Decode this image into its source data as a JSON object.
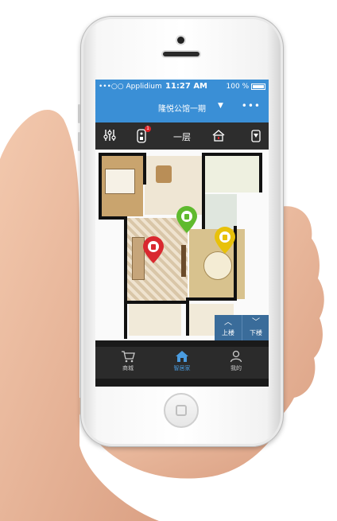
{
  "status_bar": {
    "carrier": "•••○○ Applidium",
    "time": "11:27 AM",
    "battery": "100 %"
  },
  "header": {
    "title": "隆悦公馆一期",
    "dropdown_icon": "caret-down-icon",
    "more_label": "•••"
  },
  "toolbar": {
    "items": [
      {
        "icon": "sliders-icon"
      },
      {
        "icon": "remote-icon",
        "badge": "1"
      },
      {
        "label": "一层"
      },
      {
        "icon": "home-lock-icon"
      },
      {
        "icon": "lamp-icon"
      }
    ]
  },
  "floor_controls": {
    "up_label": "上楼",
    "down_label": "下楼"
  },
  "bottom_nav": {
    "items": [
      {
        "label": "商城",
        "icon": "cart-icon",
        "active": false
      },
      {
        "label": "智居家",
        "icon": "home-icon",
        "active": true
      },
      {
        "label": "我的",
        "icon": "user-icon",
        "active": false
      }
    ]
  },
  "colors": {
    "header_bg": "#3a8fd6",
    "toolbar_bg": "#2d2d2d",
    "nav_active": "#4a9ce0",
    "pin_red": "#d9282f",
    "pin_green": "#5fba2e",
    "pin_yellow": "#e8c10a"
  }
}
